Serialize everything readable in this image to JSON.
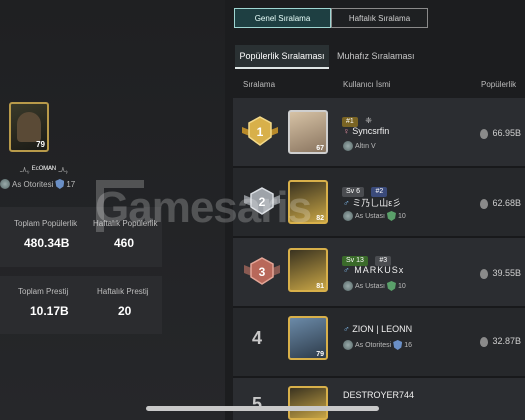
{
  "player": {
    "avatar_level": "79",
    "name": "ᴱᶜᴼᴹᴬᴺ",
    "name_deco_left": "ﮩ٨ـ",
    "name_deco_right": "ﮩ٨ـ",
    "tier": "As Otoritesi",
    "tier_num": "17"
  },
  "stats": {
    "total_pop_label": "Toplam Popülerlik",
    "total_pop_value": "480.34B",
    "weekly_pop_label": "Haftalık Popülerlik",
    "weekly_pop_value": "460",
    "total_prestige_label": "Toplam Prestij",
    "total_prestige_value": "10.17B",
    "weekly_prestige_label": "Haftalık Prestij",
    "weekly_prestige_value": "20"
  },
  "tabs": {
    "general": "Genel Sıralama",
    "weekly": "Haftalık Sıralama"
  },
  "subtabs": {
    "popularity": "Popülerlik Sıralaması",
    "guardian": "Muhafız Sıralaması"
  },
  "columns": {
    "rank": "Sıralama",
    "username": "Kullanıcı İsmi",
    "popularity": "Popülerlik"
  },
  "rows": [
    {
      "rank": "1",
      "avatar_level": "67",
      "badges": [
        "#1"
      ],
      "gender_icon": "♀",
      "name": "Syncsrfin",
      "tier": "Altın V",
      "tier_num": "",
      "popularity": "66.95B"
    },
    {
      "rank": "2",
      "avatar_level": "82",
      "badges": [
        "Sv 6",
        "#2"
      ],
      "gender_icon": "♂",
      "name": "ミ乃乚山ε彡",
      "tier": "As Ustası",
      "tier_num": "10",
      "popularity": "62.68B"
    },
    {
      "rank": "3",
      "avatar_level": "81",
      "badges": [
        "Sv 13",
        "#3"
      ],
      "gender_icon": "♂",
      "name": "MARKUSx",
      "tier": "As Ustası",
      "tier_num": "10",
      "popularity": "39.55B"
    },
    {
      "rank": "4",
      "avatar_level": "79",
      "badges": [],
      "gender_icon": "♂",
      "name": "ZION | LEONN",
      "tier": "As Otoritesi",
      "tier_num": "16",
      "popularity": "32.87B"
    },
    {
      "rank": "5",
      "avatar_level": "",
      "badges": [],
      "gender_icon": "",
      "name": "DESTROYER744",
      "tier": "",
      "tier_num": "",
      "popularity": ""
    }
  ],
  "watermark": "Gamesaris",
  "colors": {
    "tab_active_border": "#9fd6d2",
    "rank1_gold": "#d8b04a",
    "rank2_silver": "#bfc3c8",
    "rank3_bronze": "#b8685a"
  }
}
